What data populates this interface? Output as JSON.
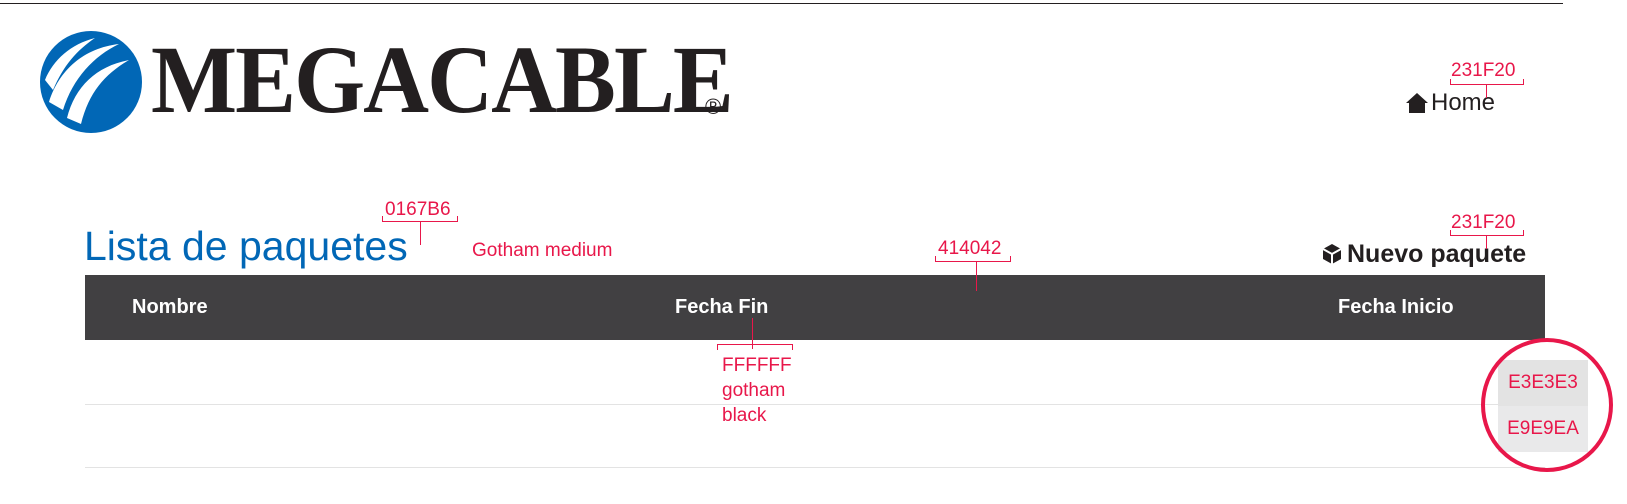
{
  "brand": {
    "name": "MEGACABLE",
    "registered": "®",
    "color": "#0167B6"
  },
  "nav": {
    "home_label": "Home",
    "home_icon": "home-icon"
  },
  "page": {
    "title": "Lista de paquetes",
    "new_button_label": "Nuevo paquete",
    "new_button_icon": "package-icon"
  },
  "table": {
    "columns": [
      "Nombre",
      "Fecha Fin",
      "Fecha Inicio"
    ],
    "header_color": "#414042",
    "rows": 2
  },
  "annotations": {
    "home_color": "231F20",
    "title_color": "0167B6",
    "title_font": "Gotham medium",
    "new_color": "231F20",
    "header_bg": "414042",
    "header_text_color": "FFFFFF",
    "header_text_font_1": "gotham",
    "header_text_font_2": "black",
    "row_color_1": "E3E3E3",
    "row_color_2": "E9E9EA"
  },
  "colors": {
    "text_dark": "#231F20",
    "accent": "#0167B6",
    "header": "#414042",
    "row_a": "#E3E3E3",
    "row_b": "#E9E9EA",
    "annotation": "#E8174A"
  }
}
